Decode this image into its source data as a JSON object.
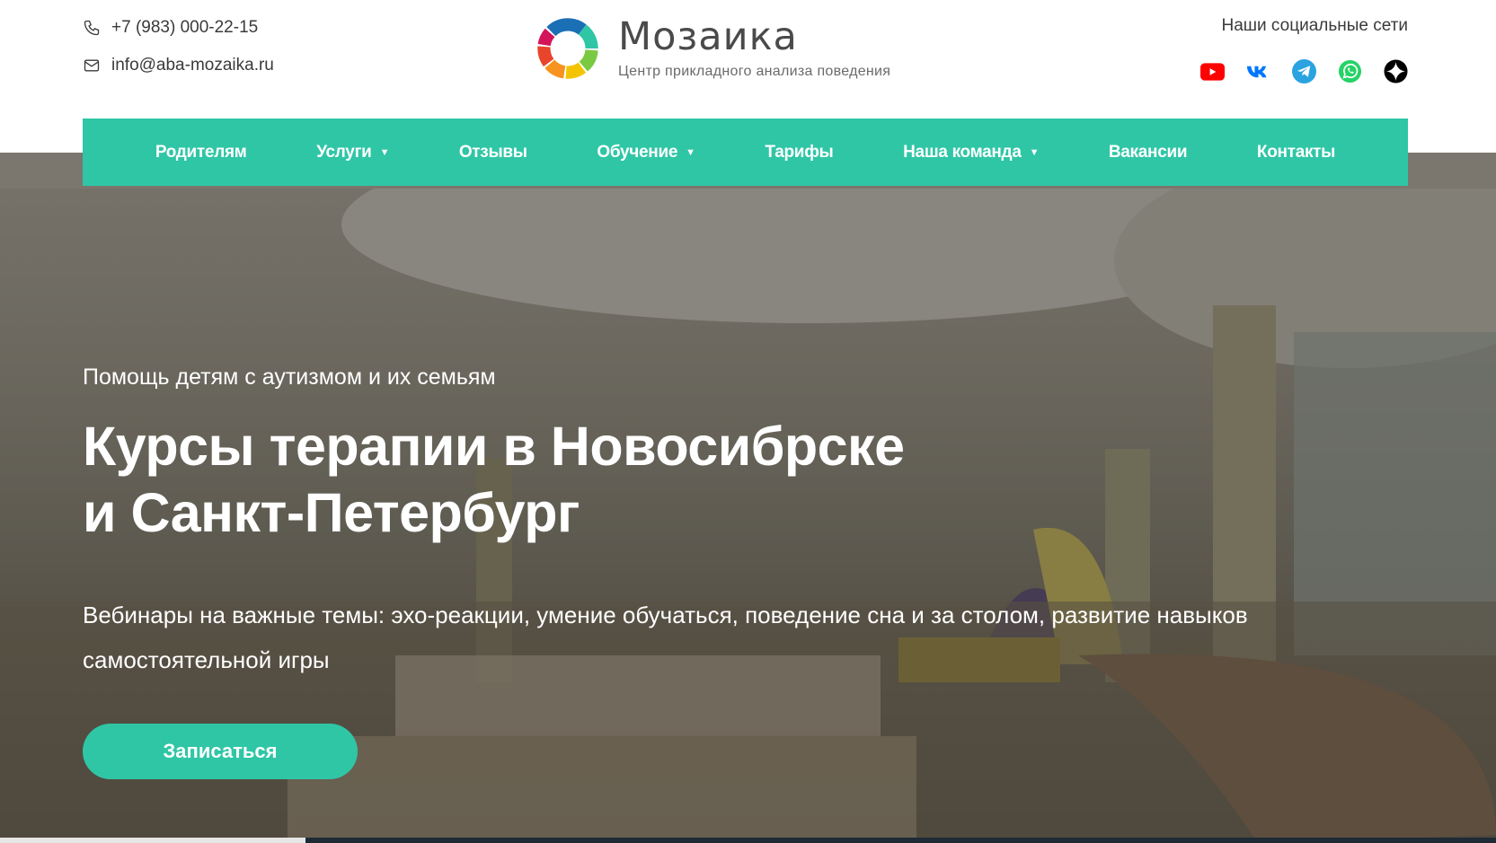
{
  "header": {
    "phone": "+7 (983) 000-22-15",
    "email": "info@aba-mozaika.ru",
    "logo_title": "Мозаика",
    "logo_subtitle": "Центр прикладного анализа поведения",
    "social_title": "Наши социальные сети",
    "social_icons": [
      "youtube-icon",
      "vk-icon",
      "telegram-icon",
      "whatsapp-icon",
      "dzen-icon"
    ]
  },
  "nav": {
    "items": [
      {
        "label": "Родителям",
        "has_dropdown": false
      },
      {
        "label": "Услуги",
        "has_dropdown": true
      },
      {
        "label": "Отзывы",
        "has_dropdown": false
      },
      {
        "label": "Обучение",
        "has_dropdown": true
      },
      {
        "label": "Тарифы",
        "has_dropdown": false
      },
      {
        "label": "Наша команда",
        "has_dropdown": true
      },
      {
        "label": "Вакансии",
        "has_dropdown": false
      },
      {
        "label": "Контакты",
        "has_dropdown": false
      }
    ],
    "caret": "▼"
  },
  "hero": {
    "kicker": "Помощь детям с аутизмом и их семьям",
    "headline_line1": "Курсы терапии в Новосибрске",
    "headline_line2": "и Санкт-Петербург",
    "description": "Вебинары на важные темы: эхо-реакции, умение обучаться, поведение сна и за столом, развитие навыков самостоятельной игры",
    "cta_label": "Записаться"
  },
  "colors": {
    "accent": "#2fc6a6",
    "text_dark": "#3a3a3a",
    "youtube": "#ff0000",
    "vk": "#0077ff",
    "telegram": "#2aa3e0",
    "whatsapp": "#25d366",
    "dzen": "#000000"
  }
}
